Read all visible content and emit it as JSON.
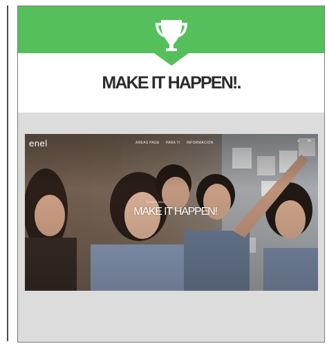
{
  "card": {
    "title": "MAKE IT HAPPEN!.",
    "icon": "trophy-icon"
  },
  "hero": {
    "logo": "enel",
    "nav": [
      "AREAS PAGE",
      "PARA TI",
      "INFORMACION"
    ],
    "kicker": "SOMOS ENEL",
    "heading": "MAKE IT HAPPEN!",
    "icons": [
      "search-icon",
      "menu-icon"
    ]
  },
  "colors": {
    "banner_green": "#55bf5b",
    "panel_gray": "#dcdcdc",
    "title_text": "#2b2b2b"
  }
}
